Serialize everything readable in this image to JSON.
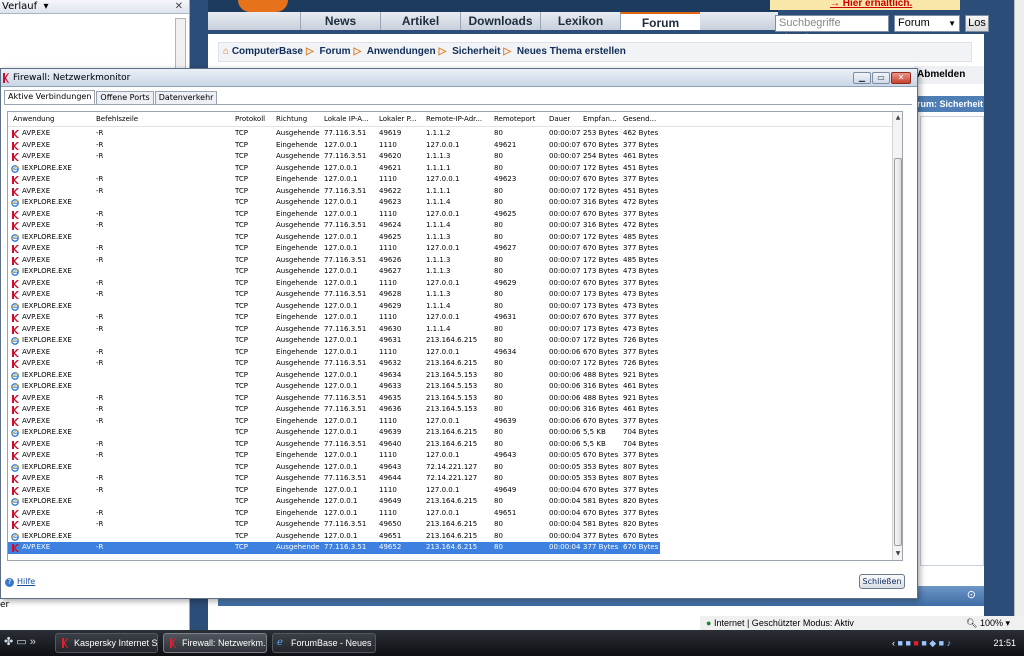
{
  "history_panel": {
    "title": "Verlauf",
    "bottom_text": "er"
  },
  "website": {
    "nav": [
      "News",
      "Artikel",
      "Downloads",
      "Lexikon",
      "Forum"
    ],
    "promo": "Hier erhältlich.",
    "search_placeholder": "Suchbegriffe eingeben",
    "search_scope": "Forum",
    "search_button": "Los",
    "breadcrumb": [
      "ComputerBase",
      "Forum",
      "Anwendungen",
      "Sicherheit",
      "Neues Thema erstellen"
    ],
    "abmelden": "Abmelden",
    "side_header": "rum: Sicherheit"
  },
  "browser_status": {
    "zone": "Internet | Geschützter Modus: Aktiv",
    "zoom": "100%"
  },
  "taskbar": {
    "tasks": [
      "Kaspersky Internet S...",
      "Firewall: Netzwerkm...",
      "ForumBase - Neues ..."
    ],
    "clock": "21:51"
  },
  "colors": {
    "selection": "#3d80df",
    "kaspersky_red": "#c8102e",
    "ie_blue": "#2f7bd9"
  },
  "firewall": {
    "title": "Firewall: Netzwerkmonitor",
    "tabs": [
      "Aktive Verbindungen",
      "Offene Ports",
      "Datenverkehr"
    ],
    "columns": [
      "Anwendung",
      "Befehlszeile",
      "Protokoll",
      "Richtung",
      "Lokale IP-A...",
      "Lokaler P...",
      "Remote-IP-Adr...",
      "Remoteport",
      "Dauer",
      "Empfan...",
      "Gesend..."
    ],
    "rows": [
      [
        "AVP.EXE",
        "-R",
        "TCP",
        "Ausgehende",
        "77.116.3.51",
        "49619",
        "1.1.1.2",
        "80",
        "00:00:07",
        "253 Bytes",
        "462 Bytes"
      ],
      [
        "AVP.EXE",
        "-R",
        "TCP",
        "Eingehende",
        "127.0.0.1",
        "1110",
        "127.0.0.1",
        "49621",
        "00:00:07",
        "670 Bytes",
        "377 Bytes"
      ],
      [
        "AVP.EXE",
        "-R",
        "TCP",
        "Ausgehende",
        "77.116.3.51",
        "49620",
        "1.1.1.3",
        "80",
        "00:00:07",
        "254 Bytes",
        "461 Bytes"
      ],
      [
        "IEXPLORE.EXE",
        "",
        "TCP",
        "Ausgehende",
        "127.0.0.1",
        "49621",
        "1.1.1.1",
        "80",
        "00:00:07",
        "172 Bytes",
        "451 Bytes"
      ],
      [
        "AVP.EXE",
        "-R",
        "TCP",
        "Eingehende",
        "127.0.0.1",
        "1110",
        "127.0.0.1",
        "49623",
        "00:00:07",
        "670 Bytes",
        "377 Bytes"
      ],
      [
        "AVP.EXE",
        "-R",
        "TCP",
        "Ausgehende",
        "77.116.3.51",
        "49622",
        "1.1.1.1",
        "80",
        "00:00:07",
        "172 Bytes",
        "451 Bytes"
      ],
      [
        "IEXPLORE.EXE",
        "",
        "TCP",
        "Ausgehende",
        "127.0.0.1",
        "49623",
        "1.1.1.4",
        "80",
        "00:00:07",
        "316 Bytes",
        "472 Bytes"
      ],
      [
        "AVP.EXE",
        "-R",
        "TCP",
        "Eingehende",
        "127.0.0.1",
        "1110",
        "127.0.0.1",
        "49625",
        "00:00:07",
        "670 Bytes",
        "377 Bytes"
      ],
      [
        "AVP.EXE",
        "-R",
        "TCP",
        "Ausgehende",
        "77.116.3.51",
        "49624",
        "1.1.1.4",
        "80",
        "00:00:07",
        "316 Bytes",
        "472 Bytes"
      ],
      [
        "IEXPLORE.EXE",
        "",
        "TCP",
        "Ausgehende",
        "127.0.0.1",
        "49625",
        "1.1.1.3",
        "80",
        "00:00:07",
        "172 Bytes",
        "485 Bytes"
      ],
      [
        "AVP.EXE",
        "-R",
        "TCP",
        "Eingehende",
        "127.0.0.1",
        "1110",
        "127.0.0.1",
        "49627",
        "00:00:07",
        "670 Bytes",
        "377 Bytes"
      ],
      [
        "AVP.EXE",
        "-R",
        "TCP",
        "Ausgehende",
        "77.116.3.51",
        "49626",
        "1.1.1.3",
        "80",
        "00:00:07",
        "172 Bytes",
        "485 Bytes"
      ],
      [
        "IEXPLORE.EXE",
        "",
        "TCP",
        "Ausgehende",
        "127.0.0.1",
        "49627",
        "1.1.1.3",
        "80",
        "00:00:07",
        "173 Bytes",
        "473 Bytes"
      ],
      [
        "AVP.EXE",
        "-R",
        "TCP",
        "Eingehende",
        "127.0.0.1",
        "1110",
        "127.0.0.1",
        "49629",
        "00:00:07",
        "670 Bytes",
        "377 Bytes"
      ],
      [
        "AVP.EXE",
        "-R",
        "TCP",
        "Ausgehende",
        "77.116.3.51",
        "49628",
        "1.1.1.3",
        "80",
        "00:00:07",
        "173 Bytes",
        "473 Bytes"
      ],
      [
        "IEXPLORE.EXE",
        "",
        "TCP",
        "Ausgehende",
        "127.0.0.1",
        "49629",
        "1.1.1.4",
        "80",
        "00:00:07",
        "173 Bytes",
        "473 Bytes"
      ],
      [
        "AVP.EXE",
        "-R",
        "TCP",
        "Eingehende",
        "127.0.0.1",
        "1110",
        "127.0.0.1",
        "49631",
        "00:00:07",
        "670 Bytes",
        "377 Bytes"
      ],
      [
        "AVP.EXE",
        "-R",
        "TCP",
        "Ausgehende",
        "77.116.3.51",
        "49630",
        "1.1.1.4",
        "80",
        "00:00:07",
        "173 Bytes",
        "473 Bytes"
      ],
      [
        "IEXPLORE.EXE",
        "",
        "TCP",
        "Ausgehende",
        "127.0.0.1",
        "49631",
        "213.164.6.215",
        "80",
        "00:00:07",
        "172 Bytes",
        "726 Bytes"
      ],
      [
        "AVP.EXE",
        "-R",
        "TCP",
        "Eingehende",
        "127.0.0.1",
        "1110",
        "127.0.0.1",
        "49634",
        "00:00:06",
        "670 Bytes",
        "377 Bytes"
      ],
      [
        "AVP.EXE",
        "-R",
        "TCP",
        "Ausgehende",
        "77.116.3.51",
        "49632",
        "213.164.6.215",
        "80",
        "00:00:07",
        "172 Bytes",
        "726 Bytes"
      ],
      [
        "IEXPLORE.EXE",
        "",
        "TCP",
        "Ausgehende",
        "127.0.0.1",
        "49634",
        "213.164.5.153",
        "80",
        "00:00:06",
        "488 Bytes",
        "921 Bytes"
      ],
      [
        "IEXPLORE.EXE",
        "",
        "TCP",
        "Ausgehende",
        "127.0.0.1",
        "49633",
        "213.164.5.153",
        "80",
        "00:00:06",
        "316 Bytes",
        "461 Bytes"
      ],
      [
        "AVP.EXE",
        "-R",
        "TCP",
        "Ausgehende",
        "77.116.3.51",
        "49635",
        "213.164.5.153",
        "80",
        "00:00:06",
        "488 Bytes",
        "921 Bytes"
      ],
      [
        "AVP.EXE",
        "-R",
        "TCP",
        "Ausgehende",
        "77.116.3.51",
        "49636",
        "213.164.5.153",
        "80",
        "00:00:06",
        "316 Bytes",
        "461 Bytes"
      ],
      [
        "AVP.EXE",
        "-R",
        "TCP",
        "Eingehende",
        "127.0.0.1",
        "1110",
        "127.0.0.1",
        "49639",
        "00:00:06",
        "670 Bytes",
        "377 Bytes"
      ],
      [
        "IEXPLORE.EXE",
        "",
        "TCP",
        "Ausgehende",
        "127.0.0.1",
        "49639",
        "213.164.6.215",
        "80",
        "00:00:06",
        "5,5 KB",
        "704 Bytes"
      ],
      [
        "AVP.EXE",
        "-R",
        "TCP",
        "Ausgehende",
        "77.116.3.51",
        "49640",
        "213.164.6.215",
        "80",
        "00:00:06",
        "5,5 KB",
        "704 Bytes"
      ],
      [
        "AVP.EXE",
        "-R",
        "TCP",
        "Eingehende",
        "127.0.0.1",
        "1110",
        "127.0.0.1",
        "49643",
        "00:00:05",
        "670 Bytes",
        "377 Bytes"
      ],
      [
        "IEXPLORE.EXE",
        "",
        "TCP",
        "Ausgehende",
        "127.0.0.1",
        "49643",
        "72.14.221.127",
        "80",
        "00:00:05",
        "353 Bytes",
        "807 Bytes"
      ],
      [
        "AVP.EXE",
        "-R",
        "TCP",
        "Ausgehende",
        "77.116.3.51",
        "49644",
        "72.14.221.127",
        "80",
        "00:00:05",
        "353 Bytes",
        "807 Bytes"
      ],
      [
        "AVP.EXE",
        "-R",
        "TCP",
        "Eingehende",
        "127.0.0.1",
        "1110",
        "127.0.0.1",
        "49649",
        "00:00:04",
        "670 Bytes",
        "377 Bytes"
      ],
      [
        "IEXPLORE.EXE",
        "",
        "TCP",
        "Ausgehende",
        "127.0.0.1",
        "49649",
        "213.164.6.215",
        "80",
        "00:00:04",
        "581 Bytes",
        "820 Bytes"
      ],
      [
        "AVP.EXE",
        "-R",
        "TCP",
        "Eingehende",
        "127.0.0.1",
        "1110",
        "127.0.0.1",
        "49651",
        "00:00:04",
        "670 Bytes",
        "377 Bytes"
      ],
      [
        "AVP.EXE",
        "-R",
        "TCP",
        "Ausgehende",
        "77.116.3.51",
        "49650",
        "213.164.6.215",
        "80",
        "00:00:04",
        "581 Bytes",
        "820 Bytes"
      ],
      [
        "IEXPLORE.EXE",
        "",
        "TCP",
        "Ausgehende",
        "127.0.0.1",
        "49651",
        "213.164.6.215",
        "80",
        "00:00:04",
        "377 Bytes",
        "670 Bytes"
      ],
      [
        "AVP.EXE",
        "-R",
        "TCP",
        "Ausgehende",
        "77.116.3.51",
        "49652",
        "213.164.6.215",
        "80",
        "00:00:04",
        "377 Bytes",
        "670 Bytes"
      ]
    ],
    "selected_row": 36,
    "help_link": "Hilfe",
    "close_button": "Schließen"
  }
}
